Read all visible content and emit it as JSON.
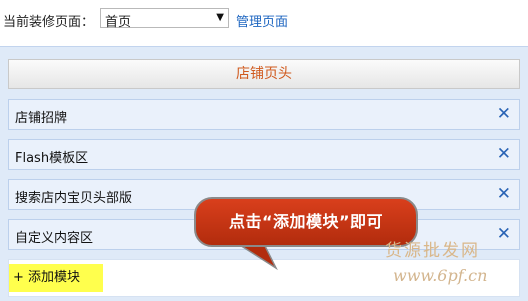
{
  "top": {
    "current_page_label": "当前装修页面：",
    "selected_page": "首页",
    "manage_link": "管理页面"
  },
  "panel": {
    "header_title": "店铺页头",
    "modules": [
      {
        "name": "店铺招牌"
      },
      {
        "name": "Flash模板区"
      },
      {
        "name": "搜索店内宝贝头部版"
      },
      {
        "name": "自定义内容区"
      }
    ],
    "add_module_label": "+ 添加模块",
    "close_symbol": "✕"
  },
  "callout": {
    "text": "点击“添加模块”即可"
  },
  "watermark": {
    "line1": "货源批发网",
    "line2": "www.6pf.cn"
  },
  "colors": {
    "accent_link": "#1e66c0",
    "header_text": "#d05a1e",
    "callout_bg": "#c4361a",
    "highlight": "#ffff4d"
  }
}
